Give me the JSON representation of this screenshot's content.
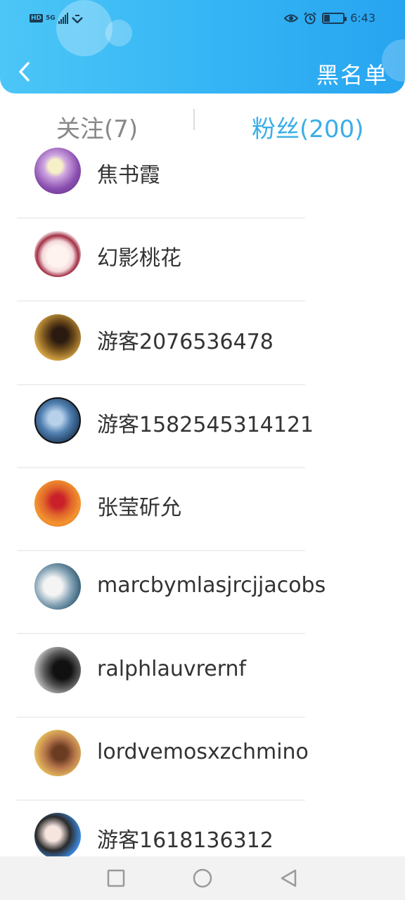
{
  "status_bar": {
    "left_badges": [
      "HD",
      "5G"
    ],
    "time": "6:43",
    "icons": [
      "eye-icon",
      "alarm-icon",
      "battery-icon"
    ]
  },
  "header": {
    "title": "黑名单",
    "back_icon": "chevron-left-icon",
    "colors": {
      "gradient_start": "#4cc6f6",
      "gradient_end": "#27a4f0"
    }
  },
  "tabs": [
    {
      "label": "关注(7)",
      "active": false
    },
    {
      "label": "粉丝(200)",
      "active": true
    }
  ],
  "accent_color": "#3aaee8",
  "list": {
    "items": [
      {
        "name": "焦书霞"
      },
      {
        "name": "幻影桃花"
      },
      {
        "name": "游客2076536478"
      },
      {
        "name": "游客1582545314121"
      },
      {
        "name": "张莹斫允"
      },
      {
        "name": "marcbymlasjrcjjacobs"
      },
      {
        "name": "ralphlauvrernf"
      },
      {
        "name": "lordvemosxzchmino"
      },
      {
        "name": "游客1618136312"
      }
    ]
  },
  "nav_bar": {
    "icons": [
      "recent-apps-icon",
      "home-icon",
      "back-icon"
    ]
  }
}
